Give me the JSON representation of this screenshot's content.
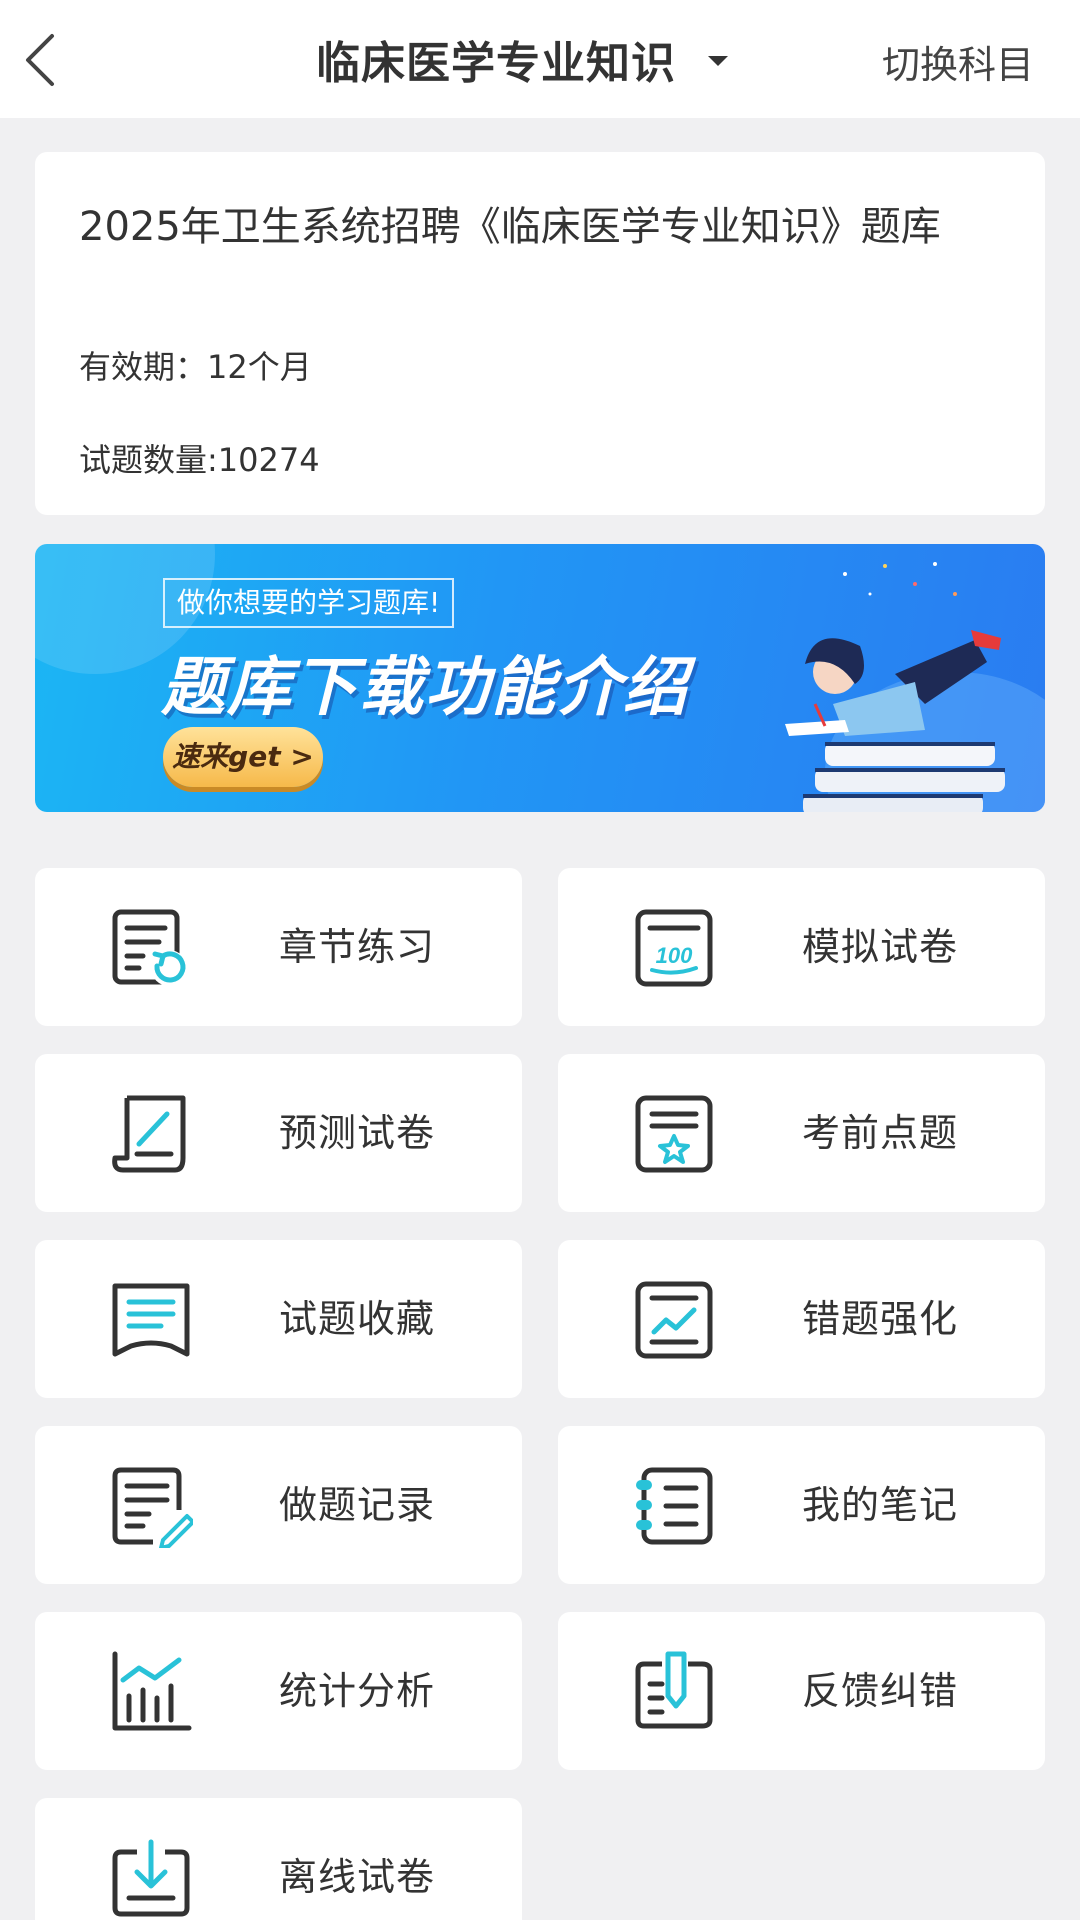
{
  "header": {
    "title": "临床医学专业知识",
    "switch_label": "切换科目",
    "back_icon": "chevron-left-icon",
    "dropdown_icon": "caret-down-icon"
  },
  "info": {
    "title": "2025年卫生系统招聘《临床医学专业知识》题库",
    "validity": "有效期：12个月",
    "count": "试题数量:10274"
  },
  "banner": {
    "slogan": "做你想要的学习题库!",
    "headline": "题库下载功能介绍",
    "cta": "速来get >"
  },
  "tiles": [
    {
      "label": "章节练习",
      "icon": "chapter-practice-icon"
    },
    {
      "label": "模拟试卷",
      "icon": "mock-exam-icon"
    },
    {
      "label": "预测试卷",
      "icon": "prediction-exam-icon"
    },
    {
      "label": "考前点题",
      "icon": "key-questions-icon"
    },
    {
      "label": "试题收藏",
      "icon": "favorites-icon"
    },
    {
      "label": "错题强化",
      "icon": "wrong-questions-icon"
    },
    {
      "label": "做题记录",
      "icon": "practice-record-icon"
    },
    {
      "label": "我的笔记",
      "icon": "notes-icon"
    },
    {
      "label": "统计分析",
      "icon": "statistics-icon"
    },
    {
      "label": "反馈纠错",
      "icon": "feedback-icon"
    },
    {
      "label": "离线试卷",
      "icon": "offline-exam-icon"
    }
  ],
  "colors": {
    "accent": "#29c2d8",
    "icon_stroke": "#333333",
    "background": "#f0f0f2"
  }
}
